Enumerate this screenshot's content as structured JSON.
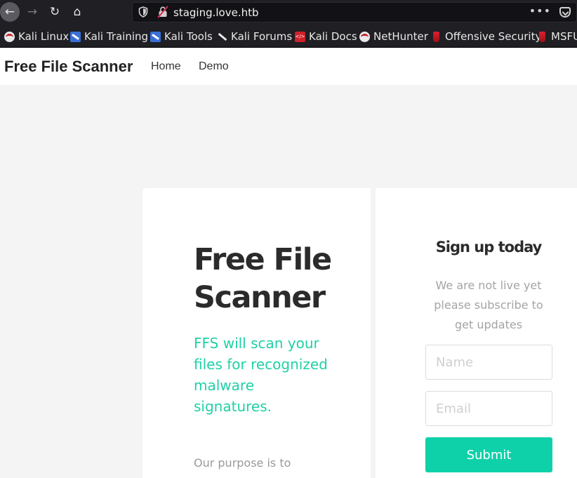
{
  "browser": {
    "url": "staging.love.htb",
    "menu_dots": "•••",
    "back_icon": "←",
    "forward_icon": "→",
    "reload_icon": "↻",
    "home_icon": "⌂"
  },
  "bookmarks": [
    {
      "label": "Kali Linux",
      "icon": "kali-icon"
    },
    {
      "label": "Kali Training",
      "icon": "kali-training-icon"
    },
    {
      "label": "Kali Tools",
      "icon": "kali-tools-icon"
    },
    {
      "label": "Kali Forums",
      "icon": "kali-forums-icon"
    },
    {
      "label": "Kali Docs",
      "icon": "kali-docs-icon"
    },
    {
      "label": "NetHunter",
      "icon": "nethunter-icon"
    },
    {
      "label": "Offensive Security",
      "icon": "offsec-icon"
    },
    {
      "label": "MSFU",
      "icon": "msfu-icon"
    }
  ],
  "site": {
    "brand": "Free File Scanner",
    "nav": {
      "home": "Home",
      "demo": "Demo"
    }
  },
  "hero": {
    "title": "Free File Scanner",
    "subtitle": "FFS will scan your files for recognized malware signatures.",
    "body": "Our purpose is to"
  },
  "signup": {
    "title": "Sign up today",
    "description": "We are not live yet please subscribe to get updates",
    "name_placeholder": "Name",
    "email_placeholder": "Email",
    "submit_label": "Submit"
  },
  "colors": {
    "accent": "#0fd1a9",
    "toolbar": "#1f1f24"
  }
}
